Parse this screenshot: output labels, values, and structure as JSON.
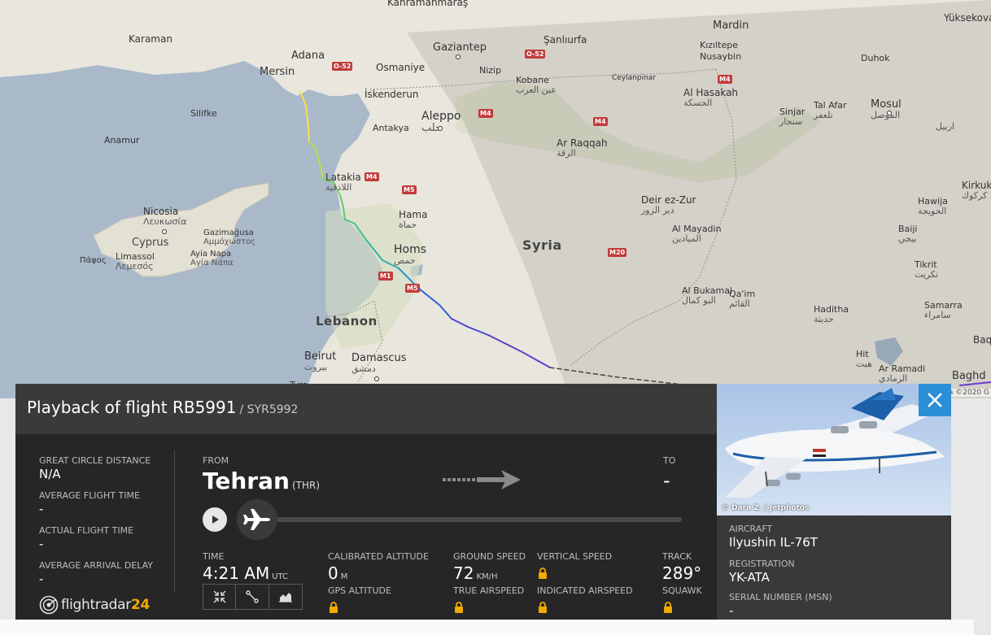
{
  "map": {
    "labels": {
      "kahramanmaras": "Kahramanmaraş",
      "yuksekova": "Yüksekova",
      "mardin": "Mardin",
      "kiziltepe": "Kızıltepe",
      "nusaybin": "Nusaybin",
      "duhok": "Duhok",
      "karaman": "Karaman",
      "adana": "Adana",
      "osmaniye": "Osmaniye",
      "gaziantep": "Gaziantep",
      "sanliurfa": "Şanlıurfa",
      "mersin": "Mersin",
      "nizip": "Nizip",
      "kobane": "Kobane",
      "kobane_ar": "عين العرب",
      "ceylanpinar": "Ceylanpinar",
      "alhasakah": "Al Hasakah",
      "alhasakah_ar": "الحسكة",
      "mosul": "Mosul",
      "mosul_ar": "الموصل",
      "erbil_ar": "اربيل",
      "silifke": "Silifke",
      "iskenderun": "İskenderun",
      "tallafar": "Tal Afar",
      "tallafar_ar": "تلعفر",
      "sinjar": "Sinjar",
      "sinjar_ar": "سنجار",
      "anamur": "Anamur",
      "antakya": "Antakya",
      "aleppo": "Aleppo",
      "aleppo_ar": "حلب",
      "arraqqah": "Ar Raqqah",
      "arraqqah_ar": "الرقة",
      "latakia": "Latakia",
      "latakia_ar": "اللاذقية",
      "kirkuk": "Kirkuk",
      "kirkuk_ar": "كركوك",
      "nicosia": "Nicosia",
      "nicosia_ar": "Λευκωσία",
      "hama": "Hama",
      "hama_ar": "حماة",
      "deirezzur": "Deir ez-Zur",
      "deirezzur_ar": "دير الزور",
      "hawija": "Hawija",
      "hawija_ar": "الحويجة",
      "cyprus": "Cyprus",
      "gazimagusa": "Gazimağusa",
      "gazimagusa_ar": "Αμμόχωστος",
      "homs": "Homs",
      "homs_ar": "حمص",
      "syria": "Syria",
      "almayadin": "Al Mayadin",
      "almayadin_ar": "الميادين",
      "baiji": "Baiji",
      "baiji_ar": "بيجي",
      "paphos": "Πάφος",
      "limassol": "Limassol",
      "limassol_ar": "Λεμεσός",
      "ayianapa": "Ayia Napa",
      "ayianapa_ar": "Αγία Νάπα",
      "tikrit": "Tikrit",
      "tikrit_ar": "تكريت",
      "albukamal": "Al Bukamal",
      "albukamal_ar": "البو كمال",
      "qaim": "Qa'im",
      "qaim_ar": "القائم",
      "samarra": "Samarra",
      "samarra_ar": "سامراء",
      "lebanon": "Lebanon",
      "haditha": "Haditha",
      "haditha_ar": "حديثة",
      "baq": "Baq",
      "beirut": "Beirut",
      "beirut_ar": "بيروت",
      "damascus": "Damascus",
      "damascus_ar": "دمشق",
      "hit": "Hit",
      "hit_ar": "هيت",
      "ramadi": "Ar Ramadi",
      "ramadi_ar": "الرمادي",
      "baghdad": "Baghd",
      "tyre": "Tyre"
    },
    "roads": {
      "o52a": "O-52",
      "o52b": "O-52",
      "m4a": "M4",
      "m4b": "M4",
      "m4c": "M4",
      "m4d": "M4",
      "m5a": "M5",
      "m5b": "M5",
      "m1": "M1",
      "m20": "M20"
    },
    "attribution": "ta ©2020 G"
  },
  "header": {
    "title": "Playback of flight RB5991",
    "callsign": "/ SYR5992"
  },
  "left_stats": [
    {
      "label": "GREAT CIRCLE DISTANCE",
      "value": "N/A"
    },
    {
      "label": "AVERAGE FLIGHT TIME",
      "value": "-"
    },
    {
      "label": "ACTUAL FLIGHT TIME",
      "value": "-"
    },
    {
      "label": "AVERAGE ARRIVAL DELAY",
      "value": "-"
    }
  ],
  "logo": {
    "text": "flightradar",
    "num": "24"
  },
  "route": {
    "from_label": "FROM",
    "from_city": "Tehran",
    "from_code": "(THR)",
    "to_label": "TO",
    "to_city": "-"
  },
  "playback": {
    "progress": 0.0
  },
  "metrics": {
    "time_label": "TIME",
    "time_value": "4:21 AM",
    "time_unit": "UTC",
    "cal_alt_label": "CALIBRATED ALTITUDE",
    "cal_alt_value": "0",
    "cal_alt_unit": "M",
    "gps_alt_label": "GPS ALTITUDE",
    "ground_speed_label": "GROUND SPEED",
    "ground_speed_value": "72",
    "ground_speed_unit": "KM/H",
    "true_airspeed_label": "TRUE AIRSPEED",
    "vertical_speed_label": "VERTICAL SPEED",
    "indicated_airspeed_label": "INDICATED AIRSPEED",
    "track_label": "TRACK",
    "track_value": "289°",
    "squawk_label": "SQUAWK"
  },
  "aircraft": {
    "photo_credit": "© Dara Z. | Jetphotos",
    "type_label": "AIRCRAFT",
    "type_value": "Ilyushin IL-76T",
    "reg_label": "REGISTRATION",
    "reg_value": "YK-ATA",
    "msn_label": "SERIAL NUMBER (MSN)",
    "msn_value": "-"
  },
  "colors": {
    "accent": "#2a8fd6",
    "panel_dark": "#262626",
    "header_dark": "#3a3a3a",
    "logo_yellow": "#f2a900"
  }
}
